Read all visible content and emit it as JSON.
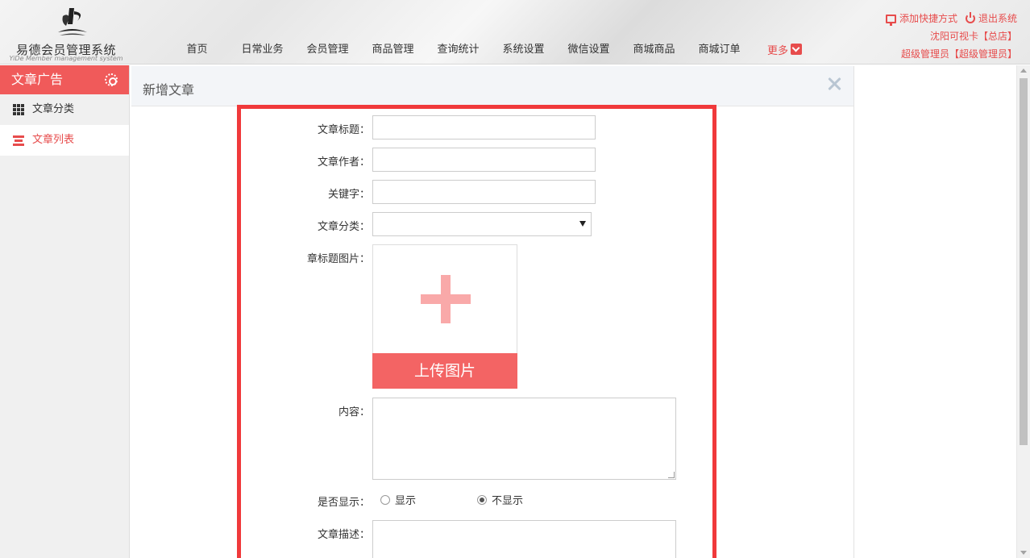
{
  "logo": {
    "title": "易德会员管理系统",
    "subtitle": "YiDe Member management system"
  },
  "nav": {
    "items": [
      "首页",
      "日常业务",
      "会员管理",
      "商品管理",
      "查询统计",
      "系统设置",
      "微信设置",
      "商城商品",
      "商城订单"
    ],
    "more": "更多"
  },
  "topright": {
    "add_shortcut": "添加快捷方式",
    "logout": "退出系统",
    "store": "沈阳可视卡【总店】",
    "user": "超级管理员【超级管理员】"
  },
  "sidebar": {
    "title": "文章广告",
    "items": [
      {
        "label": "文章分类",
        "active": false
      },
      {
        "label": "文章列表",
        "active": true
      }
    ]
  },
  "panel": {
    "title": "新增文章"
  },
  "form": {
    "title_label": "文章标题：",
    "author_label": "文章作者：",
    "keyword_label": "关键字：",
    "category_label": "文章分类：",
    "image_label": "章标题图片：",
    "upload_label": "上传图片",
    "content_label": "内容：",
    "display_label": "是否显示：",
    "show_option": "显示",
    "hide_option": "不显示",
    "selected_display": "不显示",
    "desc_label": "文章描述："
  },
  "colors": {
    "accent": "#f05a5a",
    "highlight": "#f0393b",
    "plus": "#f9a9a9"
  }
}
